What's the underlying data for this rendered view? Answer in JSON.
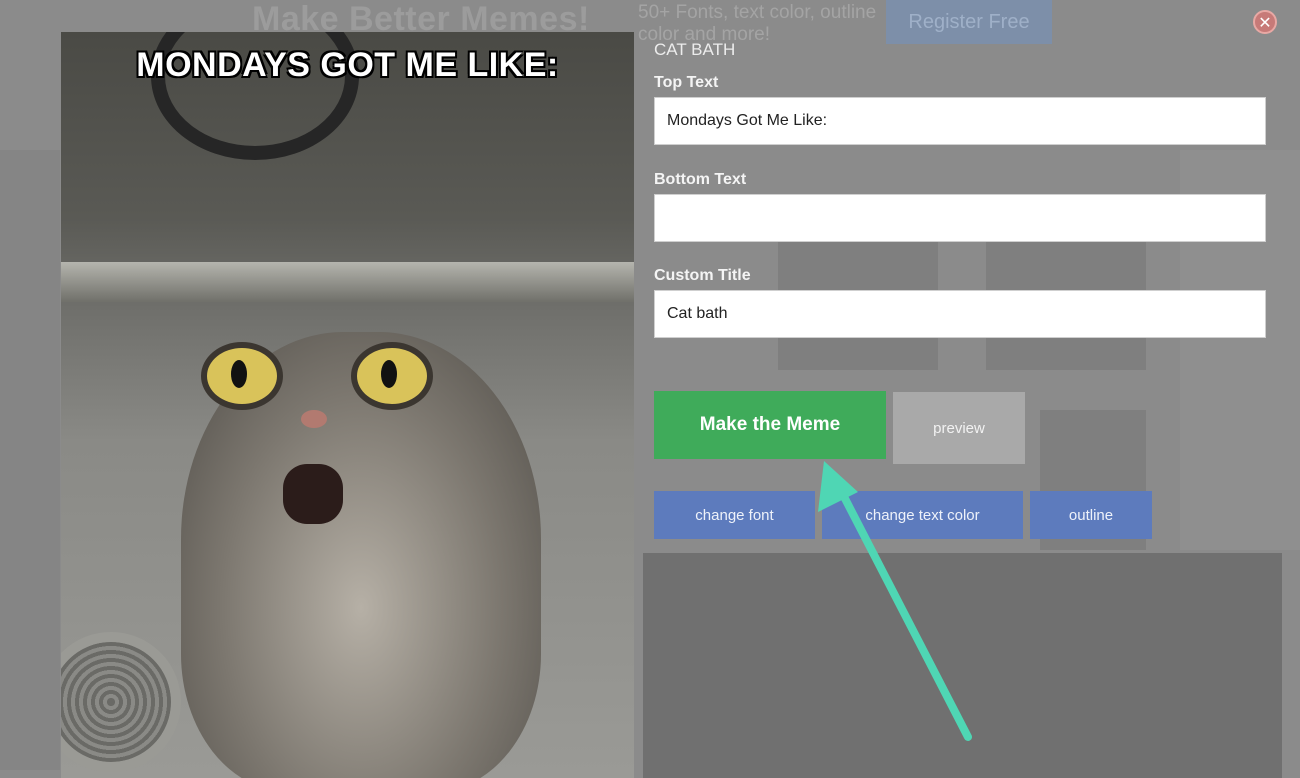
{
  "background": {
    "headline": "Make Better Memes!",
    "promo": "50+ Fonts, text color, outline color and more!",
    "register_label": "Register Free"
  },
  "meme": {
    "caption": "MONDAYS GOT ME LIKE:"
  },
  "form": {
    "title": "CAT BATH",
    "top_text_label": "Top Text",
    "top_text_value": "Mondays Got Me Like:",
    "bottom_text_label": "Bottom Text",
    "bottom_text_value": "",
    "custom_title_label": "Custom Title",
    "custom_title_value": "Cat bath"
  },
  "actions": {
    "make_label": "Make the Meme",
    "preview_label": "preview",
    "change_font_label": "change font",
    "change_text_color_label": "change text color",
    "outline_label": "outline"
  },
  "colors": {
    "make_button": "#3fab5a",
    "secondary_button": "#5d7bbd",
    "preview_button": "#a9a9a9",
    "arrow": "#4fd6b4"
  },
  "icons": {
    "close": "close-icon"
  }
}
